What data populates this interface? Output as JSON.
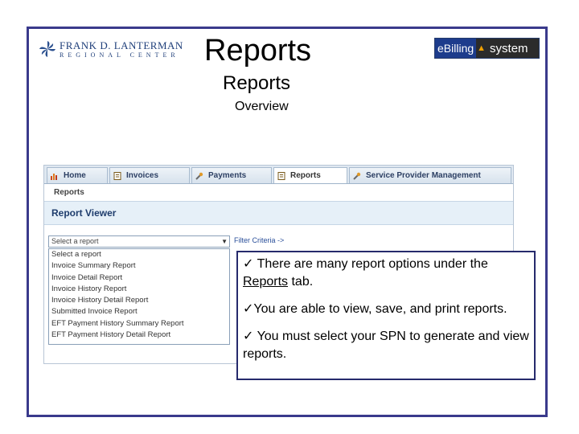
{
  "header": {
    "logo_left_line1": "FRANK D. LANTERMAN",
    "logo_left_line2": "REGIONAL CENTER",
    "title_large": "Reports",
    "title_medium": "Reports",
    "title_small": "Overview",
    "logo_right_e": "eBilling",
    "logo_right_s": "system"
  },
  "app": {
    "tabs": [
      {
        "label": "Home",
        "icon": "chart-icon"
      },
      {
        "label": "Invoices",
        "icon": "document-icon"
      },
      {
        "label": "Payments",
        "icon": "wrench-icon"
      },
      {
        "label": "Reports",
        "icon": "document-icon",
        "active": true
      },
      {
        "label": "Service Provider Management",
        "icon": "wrench-icon"
      }
    ],
    "breadcrumb": "Reports",
    "viewer_title": "Report Viewer",
    "select_value": "Select a report",
    "filter_link": "Filter Criteria ->",
    "options": [
      "Select a report",
      "Invoice Summary Report",
      "Invoice Detail Report",
      "Invoice History Report",
      "Invoice History Detail Report",
      "Submitted Invoice Report",
      "EFT Payment History Summary Report",
      "EFT Payment History Detail Report"
    ]
  },
  "callout": {
    "p1_pre": "✓ There are many report options under the ",
    "p1_link": "Reports",
    "p1_post": " tab.",
    "p2": "✓You are able to view, save, and print reports.",
    "p3": "✓ You must select your SPN to generate and view reports."
  },
  "colors": {
    "frame": "#3a3a8c",
    "accent": "#1e3c6c",
    "tab_bg": "#dfe8f1"
  }
}
